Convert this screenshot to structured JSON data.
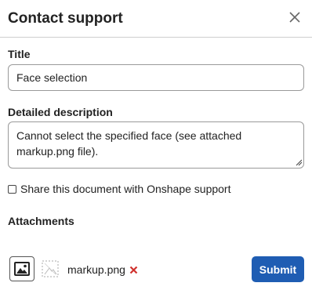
{
  "dialog": {
    "title": "Contact support",
    "close_icon": "close-icon"
  },
  "form": {
    "title_label": "Title",
    "title_value": "Face selection",
    "description_label": "Detailed description",
    "description_value": "Cannot select the specified face (see attached markup.png file).",
    "share_checked": false,
    "share_label": "Share this document with Onshape support"
  },
  "attachments": {
    "label": "Attachments",
    "add_icon": "image-icon",
    "thumb_icon": "image-placeholder-icon",
    "file_name": "markup.png",
    "remove_icon": "remove-icon",
    "remove_color": "#d0312d"
  },
  "actions": {
    "submit_label": "Submit",
    "accent": "#1f5db3"
  }
}
